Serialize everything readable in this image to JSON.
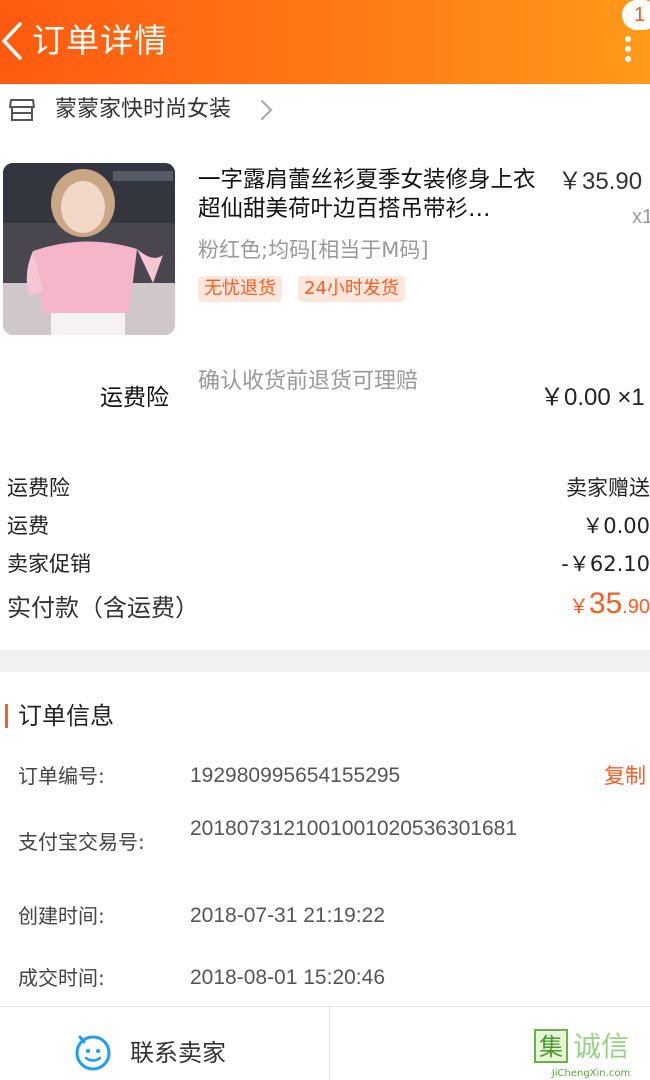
{
  "header": {
    "title": "订单详情",
    "badge_count": "1"
  },
  "shop": {
    "name": "蒙蒙家快时尚女装"
  },
  "product": {
    "title": "一字露肩蕾丝衫夏季女装修身上衣超仙甜美荷叶边百搭吊带衫…",
    "price": "￥35.90",
    "quantity": "x1",
    "sku": "粉红色;均码[相当于M码]",
    "tags": [
      "无忧退货",
      "24小时发货"
    ]
  },
  "insurance": {
    "label": "运费险",
    "description": "确认收货前退货可理赔",
    "price": "￥0.00 ×1"
  },
  "summary": {
    "rows": [
      {
        "label": "运费险",
        "value": "卖家赠送"
      },
      {
        "label": "运费",
        "value": "￥0.00"
      },
      {
        "label": "卖家促销",
        "value": "-￥62.10"
      }
    ],
    "total_label": "实付款（含运费）",
    "total_currency": "￥",
    "total_int": "35",
    "total_dec": ".90"
  },
  "order_info": {
    "title": "订单信息",
    "copy_label": "复制",
    "rows": [
      {
        "label": "订单编号:",
        "value": "192980995654155295"
      },
      {
        "label": "支付宝交易号:",
        "value": "2018073121001001020536301681"
      },
      {
        "label": "创建时间:",
        "value": "2018-07-31 21:19:22"
      },
      {
        "label": "成交时间:",
        "value": "2018-08-01 15:20:46"
      }
    ]
  },
  "bottom": {
    "contact_label": "联系卖家"
  },
  "watermark": {
    "cn": "集诚信",
    "domain": "JiChengXin.com"
  },
  "colors": {
    "accent": "#ff5a1f",
    "header_start": "#ff5a10",
    "header_end": "#ff9a1a"
  },
  "icons": [
    "back-icon",
    "more-icon",
    "shop-icon",
    "chevron-right-icon",
    "contact-seller-icon"
  ]
}
